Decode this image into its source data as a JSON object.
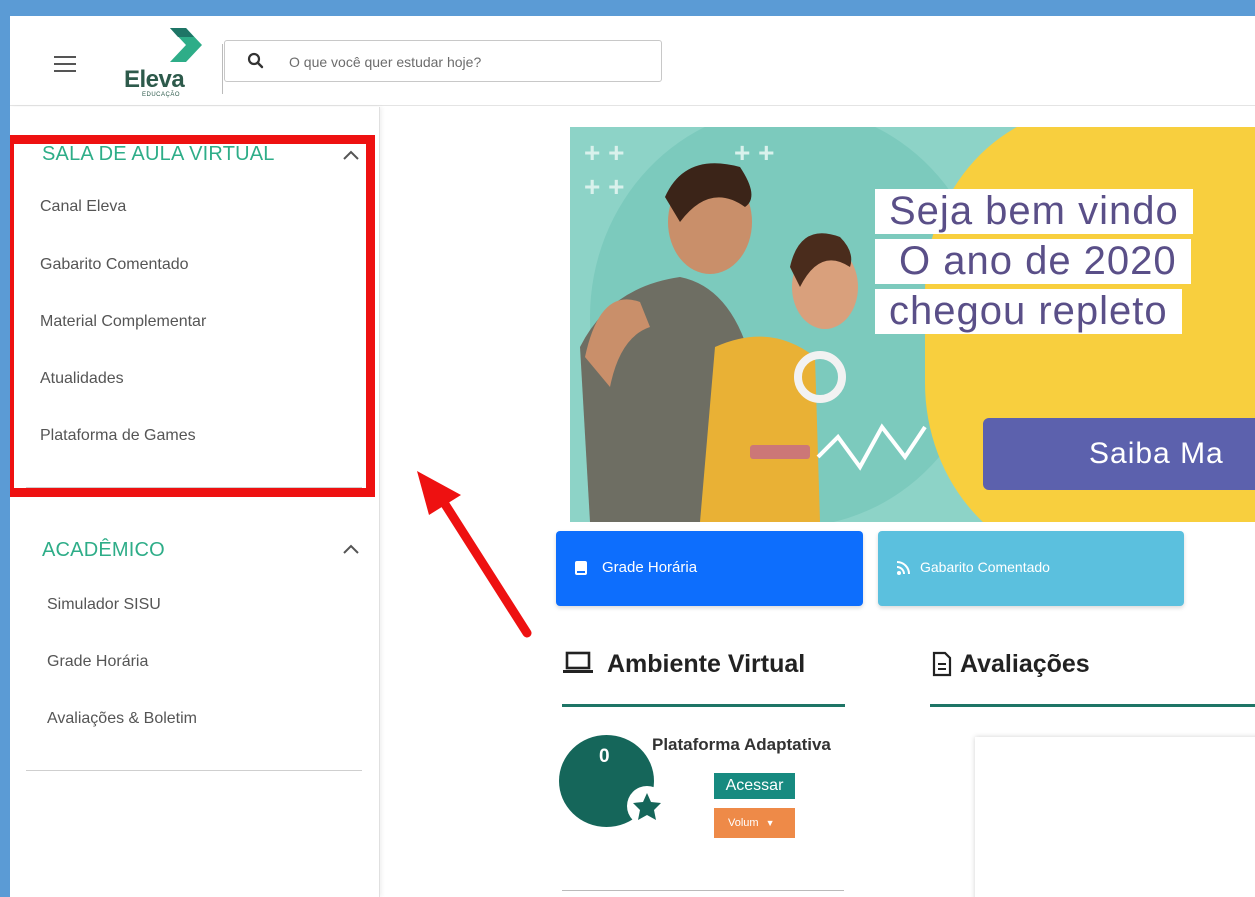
{
  "header": {
    "logo_text": "Eleva",
    "logo_sub": "EDUCAÇÃO",
    "search_placeholder": "O que você quer estudar hoje?"
  },
  "sidebar": {
    "sections": [
      {
        "title": "SALA DE AULA VIRTUAL",
        "items": [
          "Canal Eleva",
          "Gabarito Comentado",
          "Material Complementar",
          "Atualidades",
          "Plataforma de Games"
        ]
      },
      {
        "title": "ACADÊMICO",
        "items": [
          "Simulador SISU",
          "Grade Horária",
          "Avaliações & Boletim"
        ]
      }
    ]
  },
  "banner": {
    "line1": "Seja bem vindo",
    "line2": "O ano de 2020",
    "line3": "chegou repleto",
    "button": "Saiba Ma"
  },
  "tiles": {
    "grade": "Grade Horária",
    "gabarito": "Gabarito Comentado"
  },
  "ambiente": {
    "heading": "Ambiente Virtual",
    "badge_count": "0",
    "platform_title": "Plataforma Adaptativa",
    "access_button": "Acessar",
    "volume_select": "Volum"
  },
  "avaliacoes": {
    "heading": "Avaliações"
  },
  "colors": {
    "accent_green": "#2ead88",
    "dark_teal": "#15665a",
    "tile_blue": "#0d6efd",
    "tile_light_blue": "#5bc0de",
    "highlight_red": "#ee1111"
  }
}
